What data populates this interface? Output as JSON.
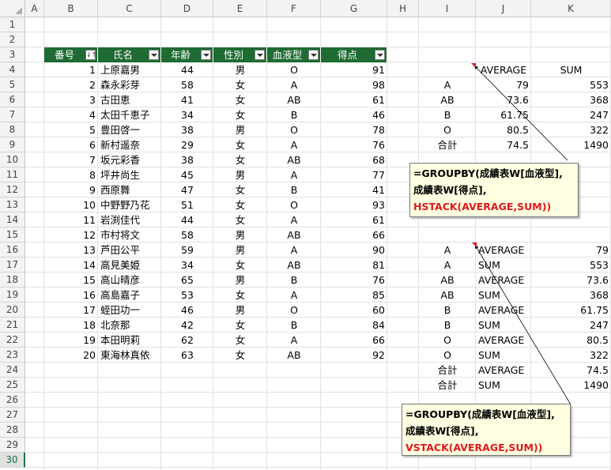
{
  "columns": [
    "A",
    "B",
    "C",
    "D",
    "E",
    "F",
    "G",
    "H",
    "I",
    "J",
    "K"
  ],
  "rows": [
    "1",
    "2",
    "3",
    "4",
    "5",
    "6",
    "7",
    "8",
    "9",
    "10",
    "11",
    "12",
    "13",
    "14",
    "15",
    "16",
    "17",
    "18",
    "19",
    "20",
    "21",
    "22",
    "23",
    "24",
    "25",
    "26",
    "27",
    "28",
    "29",
    "30"
  ],
  "selected_row": "30",
  "table": {
    "headers": [
      "番号",
      "氏名",
      "年齢",
      "性別",
      "血液型",
      "得点"
    ],
    "rows": [
      [
        "1",
        "上原嘉男",
        "44",
        "男",
        "O",
        "91"
      ],
      [
        "2",
        "森永彩芽",
        "58",
        "女",
        "A",
        "98"
      ],
      [
        "3",
        "古田恵",
        "41",
        "女",
        "AB",
        "61"
      ],
      [
        "4",
        "太田千恵子",
        "34",
        "女",
        "B",
        "46"
      ],
      [
        "5",
        "豊田啓一",
        "38",
        "男",
        "O",
        "78"
      ],
      [
        "6",
        "新村遥奈",
        "29",
        "女",
        "A",
        "76"
      ],
      [
        "7",
        "坂元彩香",
        "38",
        "女",
        "AB",
        "68"
      ],
      [
        "8",
        "坪井尚生",
        "45",
        "男",
        "A",
        "77"
      ],
      [
        "9",
        "西原舞",
        "47",
        "女",
        "B",
        "41"
      ],
      [
        "10",
        "中野野乃花",
        "51",
        "女",
        "O",
        "93"
      ],
      [
        "11",
        "岩渕佳代",
        "44",
        "女",
        "A",
        "61"
      ],
      [
        "12",
        "市村将文",
        "58",
        "男",
        "AB",
        "66"
      ],
      [
        "13",
        "芦田公平",
        "59",
        "男",
        "A",
        "90"
      ],
      [
        "14",
        "高見美姫",
        "34",
        "女",
        "AB",
        "81"
      ],
      [
        "15",
        "高山晴彦",
        "65",
        "男",
        "B",
        "76"
      ],
      [
        "16",
        "高島嘉子",
        "53",
        "女",
        "A",
        "85"
      ],
      [
        "17",
        "蛭田功一",
        "46",
        "男",
        "O",
        "60"
      ],
      [
        "18",
        "北奈那",
        "42",
        "女",
        "B",
        "84"
      ],
      [
        "19",
        "本田明莉",
        "62",
        "女",
        "A",
        "66"
      ],
      [
        "20",
        "東海林真依",
        "63",
        "女",
        "AB",
        "92"
      ]
    ]
  },
  "hstack_result": {
    "headers": [
      "AVERAGE",
      "SUM"
    ],
    "rows": [
      [
        "A",
        "79",
        "553"
      ],
      [
        "AB",
        "73.6",
        "368"
      ],
      [
        "B",
        "61.75",
        "247"
      ],
      [
        "O",
        "80.5",
        "322"
      ],
      [
        "合計",
        "74.5",
        "1490"
      ]
    ]
  },
  "vstack_result": {
    "rows": [
      [
        "A",
        "AVERAGE",
        "79"
      ],
      [
        "A",
        "SUM",
        "553"
      ],
      [
        "AB",
        "AVERAGE",
        "73.6"
      ],
      [
        "AB",
        "SUM",
        "368"
      ],
      [
        "B",
        "AVERAGE",
        "61.75"
      ],
      [
        "B",
        "SUM",
        "247"
      ],
      [
        "O",
        "AVERAGE",
        "80.5"
      ],
      [
        "O",
        "SUM",
        "322"
      ],
      [
        "合計",
        "AVERAGE",
        "74.5"
      ],
      [
        "合計",
        "SUM",
        "1490"
      ]
    ]
  },
  "note1": {
    "line1": "=GROUPBY(成績表W[血液型],",
    "line2": "成績表W[得点],",
    "line3": "HSTACK(AVERAGE,SUM))"
  },
  "note2": {
    "line1": "=GROUPBY(成績表W[血液型],",
    "line2": "成績表W[得点],",
    "line3": "VSTACK(AVERAGE,SUM))"
  },
  "colors": {
    "header_green": "#1e6b33",
    "accent_red": "#e0181b",
    "note_bg": "#ffffe1"
  }
}
